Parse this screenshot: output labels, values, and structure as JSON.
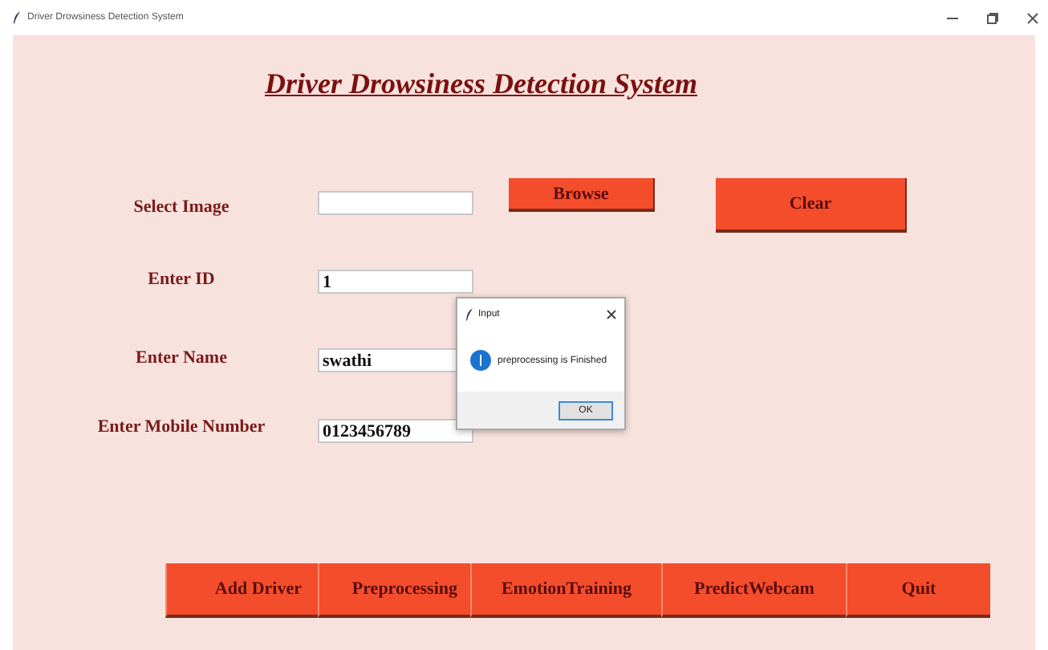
{
  "window": {
    "title": "Driver Drowsiness Detection System"
  },
  "heading": "Driver Drowsiness Detection System",
  "fields": [
    {
      "label": "Select Image"
    },
    {
      "label": "Enter ID",
      "value": "1"
    },
    {
      "label": "Enter Name",
      "value": "swathi"
    },
    {
      "label": "Enter Mobile Number",
      "value": "0123456789"
    }
  ],
  "side_buttons": [
    "Browse",
    "Clear"
  ],
  "toolbar": [
    "Add Driver",
    "Preprocessing",
    "EmotionTraining",
    "PredictWebcam",
    "Quit"
  ],
  "dialog": {
    "title": "Input",
    "message": "preprocessing is Finished",
    "button": "OK"
  }
}
